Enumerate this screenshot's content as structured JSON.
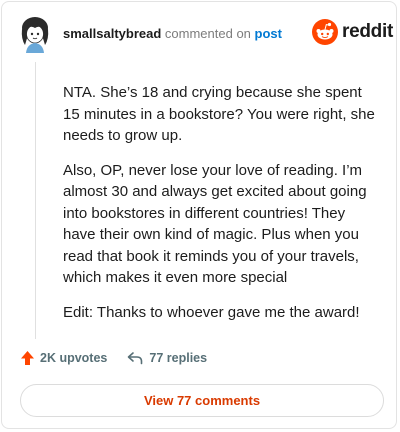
{
  "comment": {
    "username": "smallsaltybread",
    "action_text": "commented on",
    "link_text": "post",
    "paragraphs": [
      "NTA. She’s 18 and crying because she spent 15 minutes in a bookstore? You were right, she needs to grow up.",
      "Also, OP, never lose your love of reading. I’m almost 30 and always get excited about going into bookstores in different countries! They have their own kind of magic. Plus when you read that book it reminds you of your travels, which makes it even more special",
      "Edit: Thanks to whoever gave me the award!"
    ]
  },
  "brand": {
    "name": "reddit",
    "color": "#ff4500"
  },
  "actions": {
    "upvotes": "2K upvotes",
    "replies": "77 replies",
    "view_button": "View 77 comments"
  },
  "colors": {
    "link": "#0079d3",
    "upvote": "#ff4500",
    "view_button_text": "#d93a00"
  }
}
